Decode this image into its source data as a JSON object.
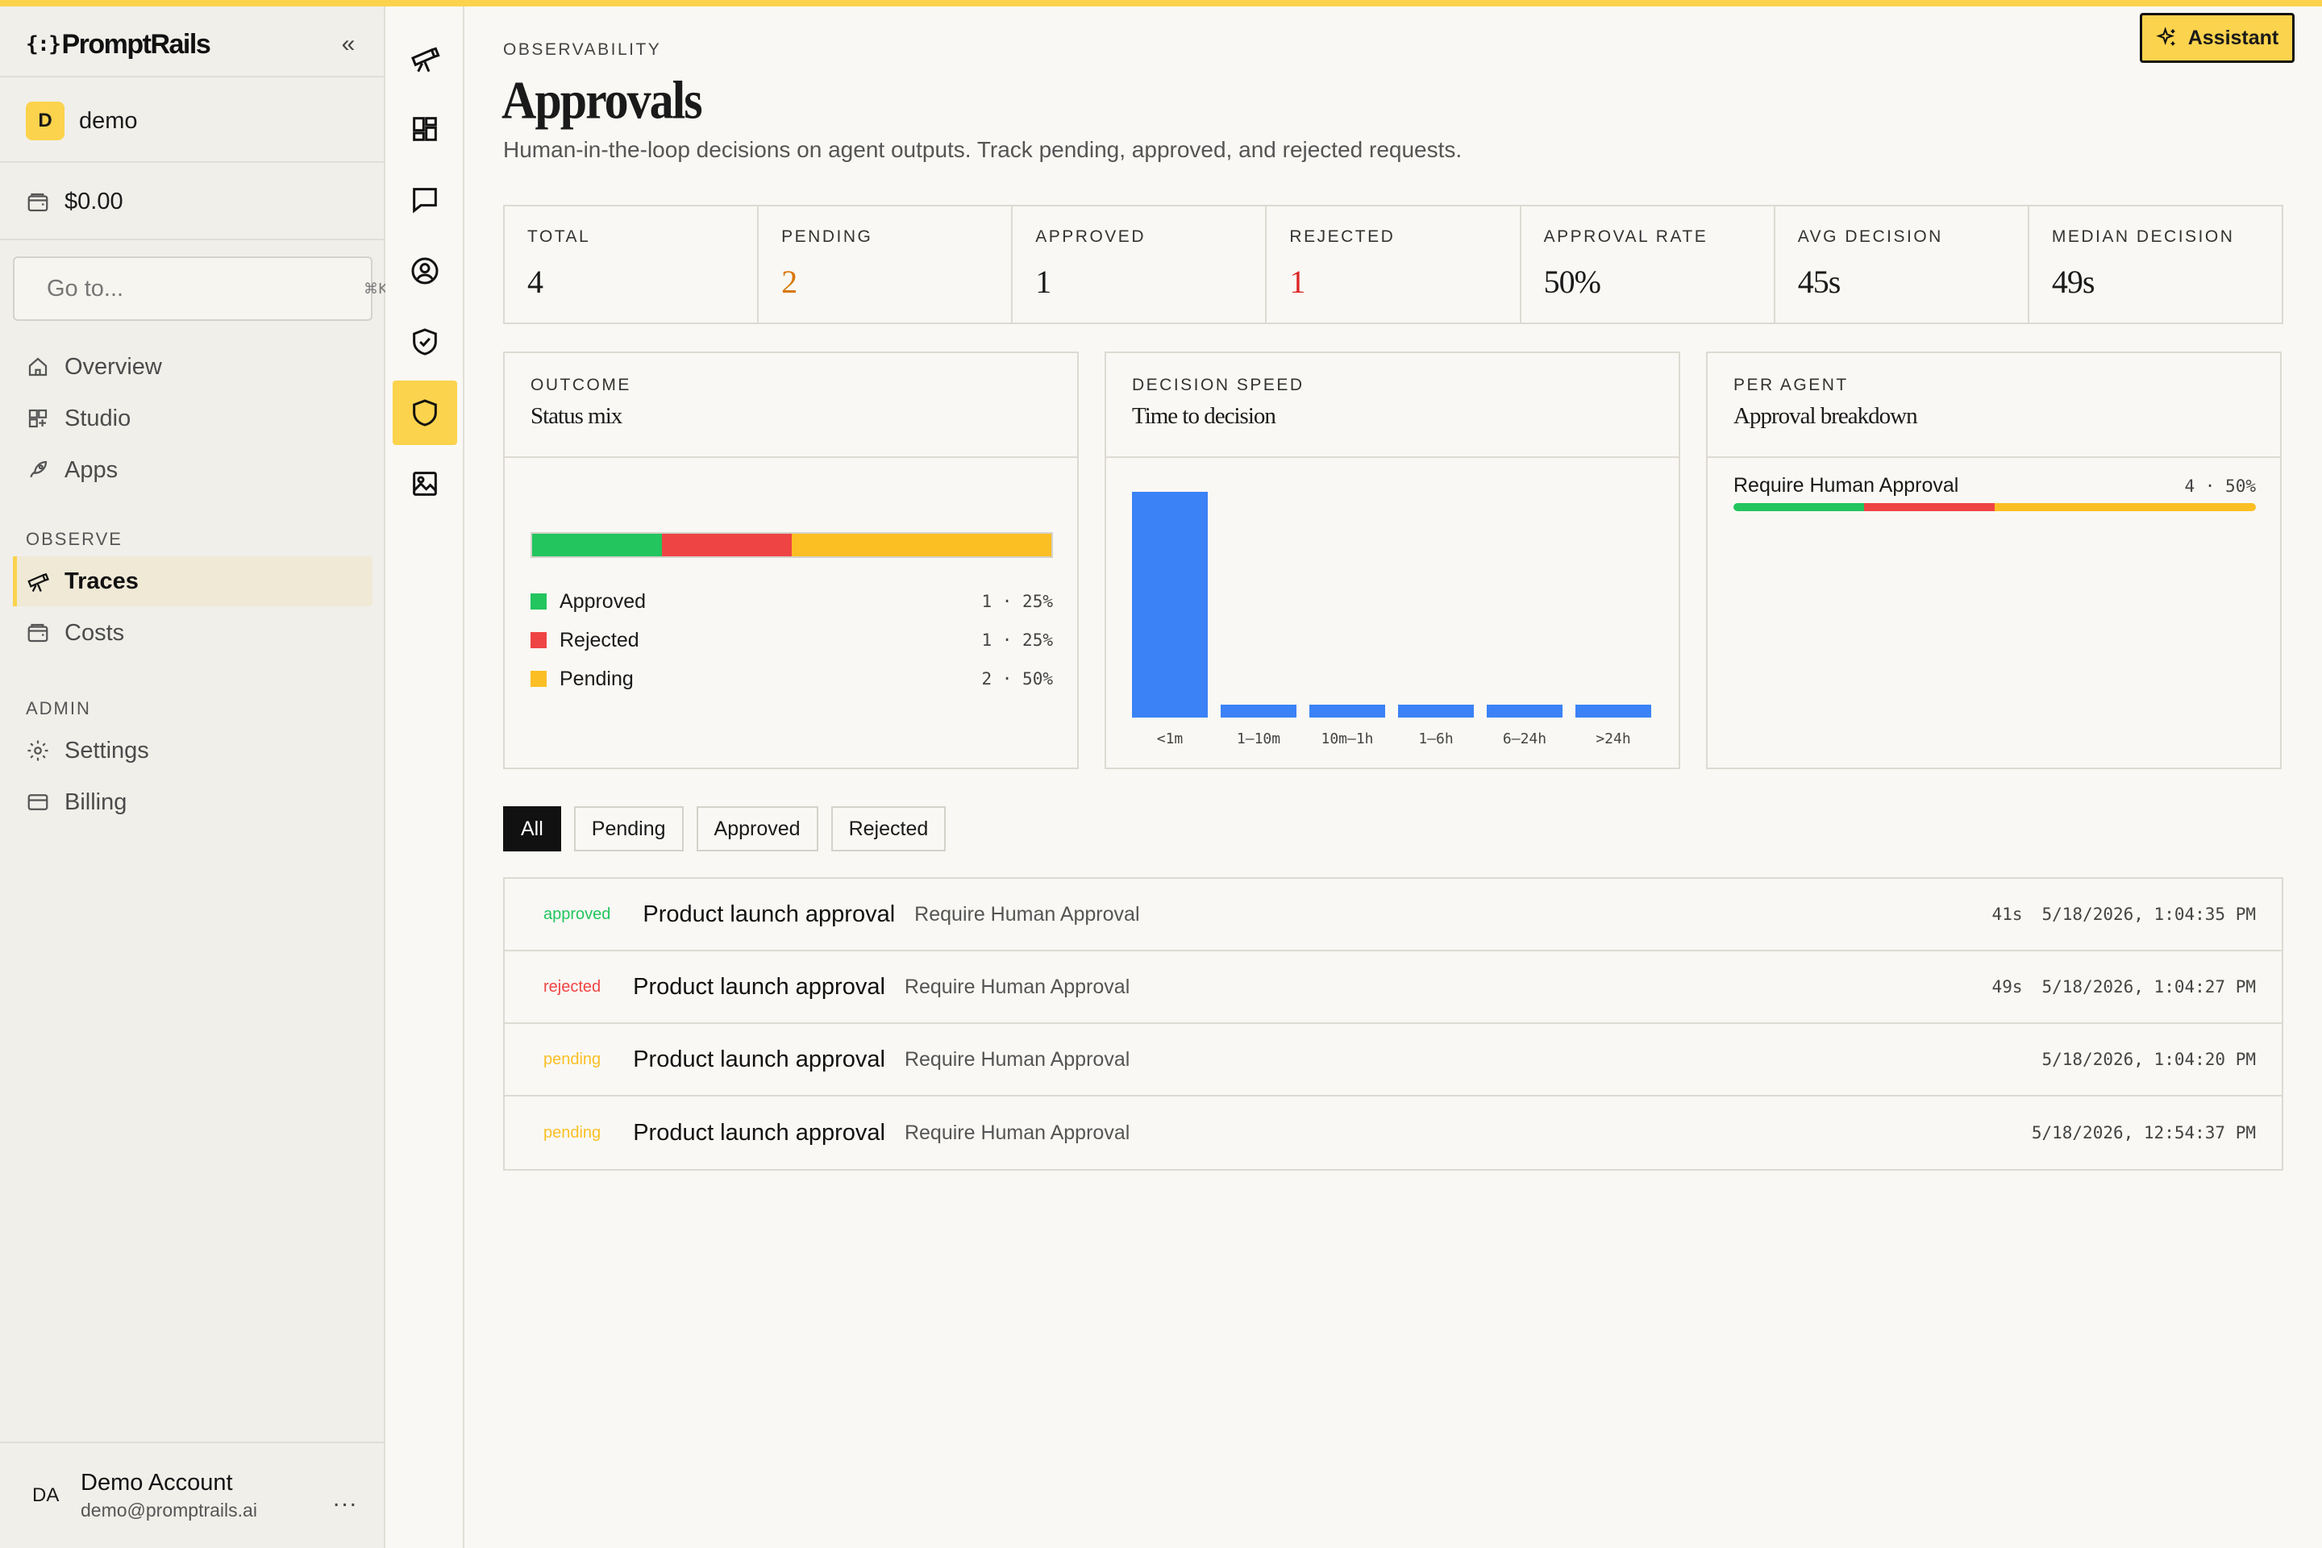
{
  "sidebar": {
    "logo_text": "PromptRails",
    "logo_bracket": "{:}",
    "collapse_glyph": "«",
    "workspace": {
      "initial": "D",
      "name": "demo"
    },
    "balance": "$0.00",
    "search": {
      "placeholder": "Go to...",
      "shortcut": "⌘K"
    },
    "nav_main": [
      {
        "label": "Overview",
        "icon": "home-icon"
      },
      {
        "label": "Studio",
        "icon": "studio-icon"
      },
      {
        "label": "Apps",
        "icon": "rocket-icon"
      }
    ],
    "observe_label": "OBSERVE",
    "nav_observe": [
      {
        "label": "Traces",
        "icon": "telescope-icon",
        "active": true
      },
      {
        "label": "Costs",
        "icon": "wallet-icon"
      }
    ],
    "admin_label": "ADMIN",
    "nav_admin": [
      {
        "label": "Settings",
        "icon": "gear-icon"
      },
      {
        "label": "Billing",
        "icon": "card-icon"
      }
    ],
    "user": {
      "initials": "DA",
      "name": "Demo Account",
      "email": "demo@promptrails.ai",
      "more": "..."
    }
  },
  "rail": {
    "items": [
      "telescope-icon",
      "dashboard-icon",
      "chat-icon",
      "user-circle-icon",
      "shield-check-icon",
      "shield-icon",
      "image-icon"
    ],
    "active_index": 5
  },
  "header": {
    "eyebrow": "OBSERVABILITY",
    "title": "Approvals",
    "subtitle": "Human-in-the-loop decisions on agent outputs. Track pending, approved, and rejected requests.",
    "assistant_label": "Assistant"
  },
  "stats": [
    {
      "label": "TOTAL",
      "value": "4",
      "color": "#1a1a1a"
    },
    {
      "label": "PENDING",
      "value": "2",
      "color": "#d97706"
    },
    {
      "label": "APPROVED",
      "value": "1",
      "color": "#1a1a1a"
    },
    {
      "label": "REJECTED",
      "value": "1",
      "color": "#dc2626"
    },
    {
      "label": "APPROVAL RATE",
      "value": "50%",
      "color": "#1a1a1a"
    },
    {
      "label": "AVG DECISION",
      "value": "45s",
      "color": "#1a1a1a"
    },
    {
      "label": "MEDIAN DECISION",
      "value": "49s",
      "color": "#1a1a1a"
    }
  ],
  "colors": {
    "approved": "#22c55e",
    "rejected": "#ef4444",
    "pending": "#fbbf24",
    "bar": "#3b82f6",
    "accent": "#fcd34d"
  },
  "outcome": {
    "eyebrow": "OUTCOME",
    "title": "Status mix",
    "legend": [
      {
        "label": "Approved",
        "value": "1 · 25%"
      },
      {
        "label": "Rejected",
        "value": "1 · 25%"
      },
      {
        "label": "Pending",
        "value": "2 · 50%"
      }
    ]
  },
  "speed": {
    "eyebrow": "DECISION SPEED",
    "title": "Time to decision"
  },
  "per_agent": {
    "eyebrow": "PER AGENT",
    "title": "Approval breakdown",
    "agents": [
      {
        "name": "Require Human Approval",
        "value": "4 · 50%",
        "approved": 1,
        "rejected": 1,
        "pending": 2
      }
    ]
  },
  "chart_data": [
    {
      "type": "bar",
      "title": "Status mix",
      "orientation": "horizontal-stacked",
      "categories": [
        "Approved",
        "Rejected",
        "Pending"
      ],
      "values": [
        1,
        1,
        2
      ],
      "percent": [
        25,
        25,
        50
      ]
    },
    {
      "type": "bar",
      "title": "Time to decision",
      "categories": [
        "<1m",
        "1–10m",
        "10m–1h",
        "1–6h",
        "6–24h",
        ">24h"
      ],
      "values": [
        2,
        0,
        0,
        0,
        0,
        0
      ]
    }
  ],
  "filters": [
    {
      "label": "All",
      "active": true
    },
    {
      "label": "Pending"
    },
    {
      "label": "Approved"
    },
    {
      "label": "Rejected"
    }
  ],
  "approvals": [
    {
      "status": "approved",
      "title": "Product launch approval",
      "agent": "Require Human Approval",
      "duration": "41s",
      "date": "5/18/2026, 1:04:35 PM"
    },
    {
      "status": "rejected",
      "title": "Product launch approval",
      "agent": "Require Human Approval",
      "duration": "49s",
      "date": "5/18/2026, 1:04:27 PM"
    },
    {
      "status": "pending",
      "title": "Product launch approval",
      "agent": "Require Human Approval",
      "duration": "",
      "date": "5/18/2026, 1:04:20 PM"
    },
    {
      "status": "pending",
      "title": "Product launch approval",
      "agent": "Require Human Approval",
      "duration": "",
      "date": "5/18/2026, 12:54:37 PM"
    }
  ]
}
